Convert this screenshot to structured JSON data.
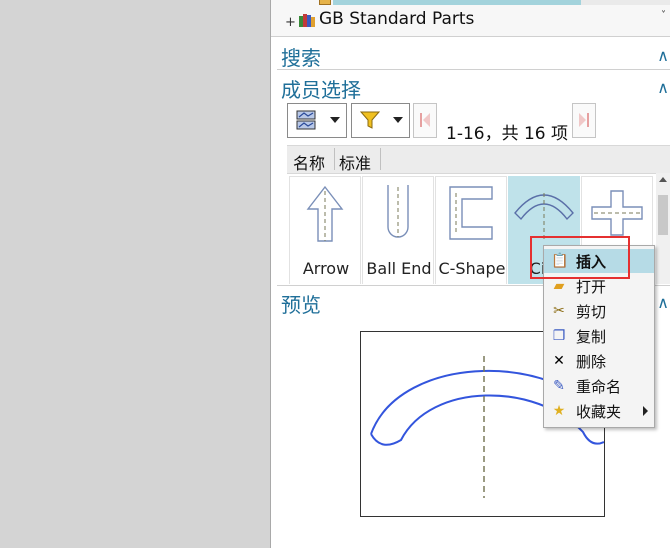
{
  "tree": {
    "expand_symbol": "+",
    "item_label": "GB Standard Parts",
    "scroll_arrow": "˅"
  },
  "sections": {
    "search": "搜索",
    "member_select": "成员选择",
    "preview": "预览",
    "collapse_icon": "∧"
  },
  "toolbar": {
    "page_label": "1-16，共 16 项"
  },
  "columns": [
    "名称",
    "标准"
  ],
  "items": [
    {
      "label": "Arrow",
      "icon": "arrow-shape-icon"
    },
    {
      "label": "Ball End",
      "icon": "ball-end-shape-icon"
    },
    {
      "label": "C-Shape",
      "icon": "c-shape-icon"
    },
    {
      "label": "Circ",
      "icon": "circular-arc-shape-icon",
      "selected": true
    },
    {
      "label": "",
      "icon": "cross-shape-icon"
    }
  ],
  "context_menu": {
    "items": [
      {
        "label": "插入",
        "icon": "insert-icon",
        "highlighted": true
      },
      {
        "label": "打开",
        "icon": "open-icon"
      },
      {
        "label": "剪切",
        "icon": "cut-icon"
      },
      {
        "label": "复制",
        "icon": "copy-icon"
      },
      {
        "label": "删除",
        "icon": "delete-icon"
      },
      {
        "label": "重命名",
        "icon": "rename-icon"
      },
      {
        "label": "收藏夹",
        "icon": "favorites-icon",
        "has_submenu": true
      }
    ]
  },
  "colors": {
    "section_heading": "#1f6f99",
    "selection": "#bfe2ea",
    "highlight_border": "#e53030",
    "preview_stroke": "#3355dd"
  }
}
